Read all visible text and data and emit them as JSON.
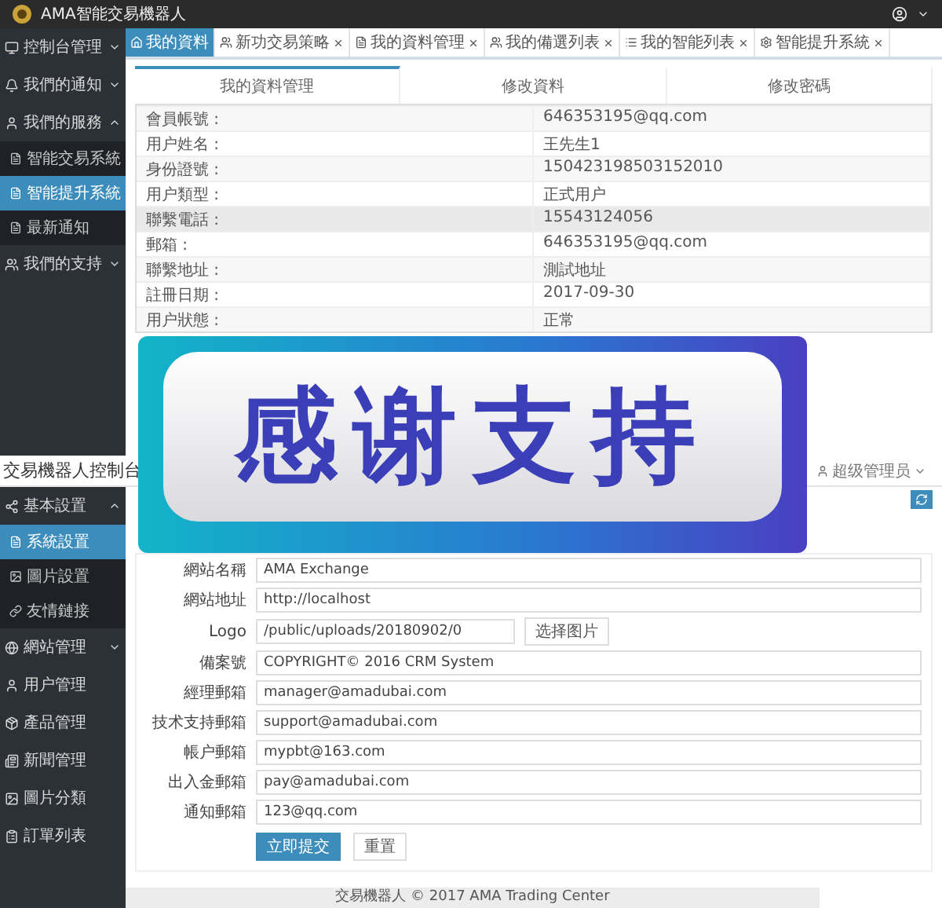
{
  "top": {
    "header": {
      "title": "AMA智能交易機器人"
    },
    "sidebar": [
      {
        "label": "控制台管理",
        "expanded": false
      },
      {
        "label": "我們的通知",
        "expanded": false
      },
      {
        "label": "我們的服務",
        "expanded": true,
        "children": [
          {
            "label": "智能交易系統",
            "selected": false
          },
          {
            "label": "智能提升系統",
            "selected": true
          },
          {
            "label": "最新通知",
            "selected": false
          }
        ]
      },
      {
        "label": "我們的支持",
        "expanded": false
      }
    ],
    "tabs": [
      {
        "label": "我的資料",
        "selected": true
      },
      {
        "label": "新功交易策略",
        "selected": false
      },
      {
        "label": "我的資料管理",
        "selected": false
      },
      {
        "label": "我的備選列表",
        "selected": false
      },
      {
        "label": "我的智能列表",
        "selected": false
      },
      {
        "label": "智能提升系統",
        "selected": false
      }
    ],
    "subtabs": [
      {
        "label": "我的資料管理",
        "selected": true
      },
      {
        "label": "修改資料",
        "selected": false
      },
      {
        "label": "修改密碼",
        "selected": false
      }
    ],
    "profile_rows": [
      {
        "label": "會員帳號 :",
        "value": "646353195@qq.com",
        "highlighted": false
      },
      {
        "label": "用户姓名 :",
        "value": "王先生1",
        "highlighted": false
      },
      {
        "label": "身份證號 :",
        "value": "150423198503152010",
        "highlighted": false
      },
      {
        "label": "用户類型 :",
        "value": "正式用户",
        "highlighted": false
      },
      {
        "label": "聯繫電話 :",
        "value": "15543124056",
        "highlighted": true
      },
      {
        "label": "郵箱 :",
        "value": "646353195@qq.com",
        "highlighted": false
      },
      {
        "label": "聯繫地址 :",
        "value": "測試地址",
        "highlighted": false
      },
      {
        "label": "註冊日期 :",
        "value": "2017-09-30",
        "highlighted": false
      },
      {
        "label": "用户狀態 :",
        "value": "正常",
        "highlighted": false
      }
    ]
  },
  "banner": {
    "text": "感谢支持"
  },
  "bottom": {
    "title": "交易機器人控制台",
    "user_menu": "超级管理员",
    "sidebar": [
      {
        "label": "基本設置",
        "expanded": true,
        "children": [
          {
            "label": "系統設置",
            "selected": true
          },
          {
            "label": "圖片設置",
            "selected": false
          },
          {
            "label": "友情鏈接",
            "selected": false
          }
        ]
      },
      {
        "label": "網站管理",
        "expanded": false
      },
      {
        "label": "用户管理"
      },
      {
        "label": "產品管理"
      },
      {
        "label": "新聞管理"
      },
      {
        "label": "圖片分類"
      },
      {
        "label": "訂單列表"
      }
    ],
    "form_rows": [
      {
        "kind": "text",
        "label": "網站名稱",
        "value": "AMA Exchange"
      },
      {
        "kind": "text",
        "label": "網站地址",
        "value": "http://localhost"
      },
      {
        "kind": "file",
        "label": "Logo",
        "value": "/public/uploads/20180902/0",
        "button": "选择图片"
      },
      {
        "kind": "text",
        "label": "備案號",
        "value": "COPYRIGHT© 2016 CRM System"
      },
      {
        "kind": "text",
        "label": "經理郵箱",
        "value": "manager@amadubai.com"
      },
      {
        "kind": "text",
        "label": "技术支持郵箱",
        "value": "support@amadubai.com"
      },
      {
        "kind": "text",
        "label": "帳户郵箱",
        "value": "mypbt@163.com"
      },
      {
        "kind": "text",
        "label": "出入金郵箱",
        "value": "pay@amadubai.com"
      },
      {
        "kind": "text",
        "label": "通知郵箱",
        "value": "123@qq.com"
      }
    ],
    "buttons": [
      {
        "label": "立即提交",
        "kind": "primary"
      },
      {
        "label": "重置",
        "kind": "default"
      }
    ],
    "footer": "交易機器人 © 2017  AMA Trading Center"
  }
}
